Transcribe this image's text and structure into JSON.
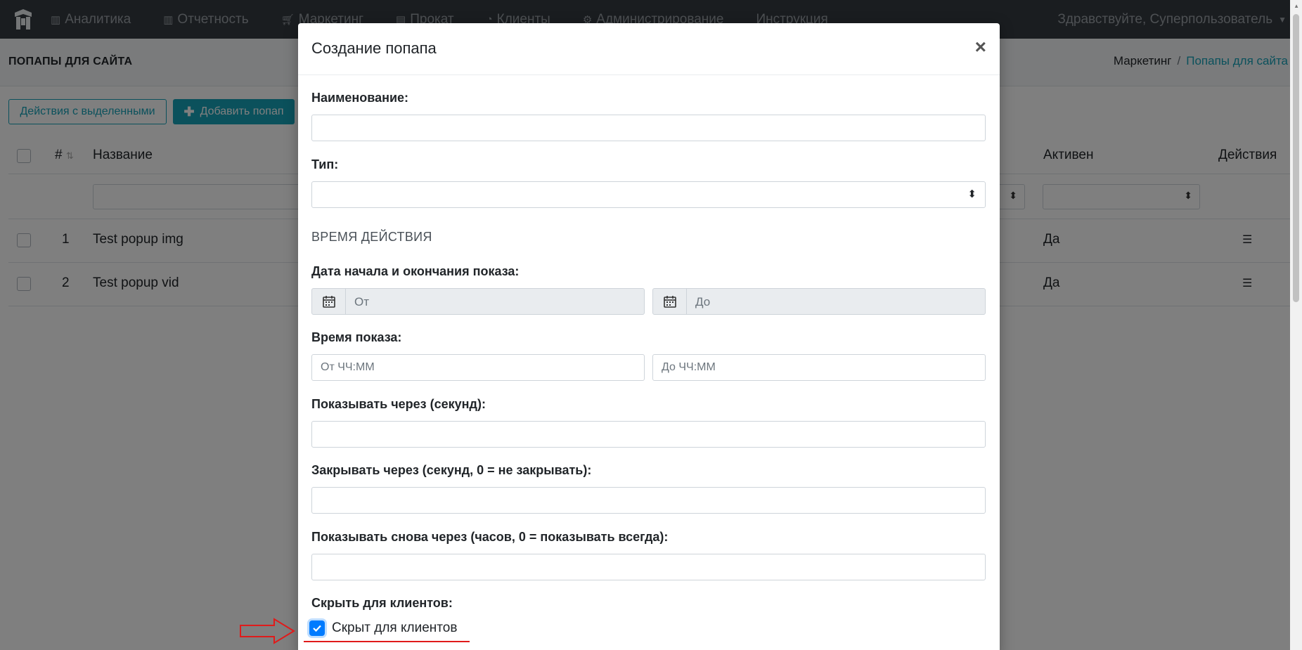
{
  "navbar": {
    "items": [
      {
        "label": "Аналитика",
        "icon": "bar-chart-icon"
      },
      {
        "label": "Отчетность",
        "icon": "bar-chart-icon"
      },
      {
        "label": "Маркетинг",
        "icon": "cart-icon"
      },
      {
        "label": "Прокат",
        "icon": "building-icon"
      },
      {
        "label": "Клиенты",
        "icon": "user-icon"
      },
      {
        "label": "Администрирование",
        "icon": "gears-icon"
      },
      {
        "label": "Инструкция",
        "icon": ""
      }
    ],
    "greeting": "Здравствуйте, Суперпользователь"
  },
  "page": {
    "title": "ПОПАПЫ ДЛЯ САЙТА",
    "breadcrumb": [
      "Маркетинг",
      "Попапы для сайта"
    ]
  },
  "toolbar": {
    "bulk_label": "Действия с выделенными",
    "add_label": "Добавить попап"
  },
  "table": {
    "headers": {
      "num": "#",
      "name": "Название",
      "active": "Активен",
      "actions": "Действия"
    },
    "rows": [
      {
        "num": "1",
        "name": "Test popup img",
        "active": "Да"
      },
      {
        "num": "2",
        "name": "Test popup vid",
        "active": "Да"
      }
    ]
  },
  "modal": {
    "title": "Создание попапа",
    "close": "×",
    "fields": {
      "name_label": "Наименование:",
      "type_label": "Тип:",
      "section_time": "ВРЕМЯ ДЕЙСТВИЯ",
      "dates_label": "Дата начала и окончания показа:",
      "date_from": "От",
      "date_to": "До",
      "time_label": "Время показа:",
      "time_from": "От ЧЧ:ММ",
      "time_to": "До ЧЧ:ММ",
      "show_after_label": "Показывать через (секунд):",
      "close_after_label": "Закрывать через (секунд, 0 = не закрывать):",
      "show_again_label": "Показывать снова через (часов, 0 = показывать всегда):",
      "hide_label": "Скрыть для клиентов:",
      "hide_checkbox": "Скрыт для клиентов"
    }
  },
  "colors": {
    "accent": "#17a2b8",
    "navbar": "#343a40",
    "checkbox": "#007bff",
    "annotation": "#e01b1b"
  }
}
